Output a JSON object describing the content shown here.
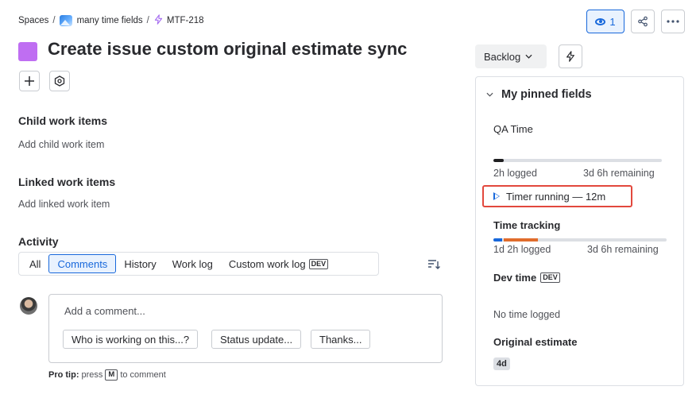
{
  "breadcrumb": {
    "spaces": "Spaces",
    "separator": "/",
    "project": "many time fields",
    "issue_key": "MTF-218"
  },
  "header": {
    "watch_count": "1",
    "title": "Create issue custom original estimate sync"
  },
  "sections": {
    "child_title": "Child work items",
    "child_add": "Add child work item",
    "linked_title": "Linked work items",
    "linked_add": "Add linked work item"
  },
  "activity": {
    "title": "Activity",
    "tabs": [
      {
        "label": "All"
      },
      {
        "label": "Comments",
        "active": true
      },
      {
        "label": "History"
      },
      {
        "label": "Work log"
      },
      {
        "label": "Custom work log",
        "badge": "DEV"
      }
    ],
    "comment_placeholder": "Add a comment...",
    "quick_replies": [
      "Who is working on this...?",
      "Status update...",
      "Thanks..."
    ],
    "pro_tip_label": "Pro tip:",
    "pro_tip_text_before": "press",
    "pro_tip_key": "M",
    "pro_tip_text_after": "to comment"
  },
  "status": {
    "label": "Backlog"
  },
  "pinned": {
    "title": "My pinned fields",
    "qa_time": {
      "label": "QA Time",
      "progress": 0.06,
      "logged": "2h logged",
      "remaining": "3d 6h remaining",
      "timer": "Timer running — 12m"
    },
    "time_tracking": {
      "label": "Time tracking",
      "logged": "1d 2h logged",
      "remaining": "3d 6h remaining",
      "progress_blue": 0.05,
      "progress_orange": 0.2
    },
    "dev_time": {
      "label": "Dev time",
      "badge": "DEV",
      "value": "No time logged"
    },
    "original_estimate": {
      "label": "Original estimate",
      "value": "4d"
    }
  },
  "colors": {
    "accent": "#1868db",
    "type_purple": "#bf6ef2",
    "timer_outline": "#e2483d",
    "progress_orange": "#e06c2c",
    "progress_dark": "#1f1f21"
  }
}
